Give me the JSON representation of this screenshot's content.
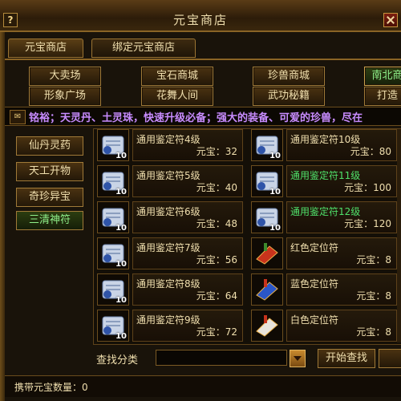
{
  "window": {
    "title": "元宝商店"
  },
  "tabs": [
    {
      "label": "元宝商店"
    },
    {
      "label": "绑定元宝商店"
    }
  ],
  "categories_row1": [
    {
      "label": "大卖场"
    },
    {
      "label": "宝石商城"
    },
    {
      "label": "珍兽商城"
    },
    {
      "label": "南北商"
    }
  ],
  "categories_row2": [
    {
      "label": "形象广场"
    },
    {
      "label": "花舞人间"
    },
    {
      "label": "武功秘籍"
    },
    {
      "label": "打造"
    }
  ],
  "marquee": {
    "text": "铭裕；天灵丹、土灵珠，快速升级必备；强大的装备、可爱的珍兽，尽在"
  },
  "sidebar": [
    {
      "label": "仙丹灵药"
    },
    {
      "label": "天工开物"
    },
    {
      "label": "奇珍异宝"
    },
    {
      "label": "三清神符"
    }
  ],
  "items": [
    {
      "name": "通用鉴定符4级",
      "price": "元宝：32",
      "qty": "10",
      "icon": "scroll-icon",
      "green": false
    },
    {
      "name": "通用鉴定符10级",
      "price": "元宝：80",
      "qty": "10",
      "icon": "scroll-icon",
      "green": false
    },
    {
      "name": "通用鉴定符5级",
      "price": "元宝：40",
      "qty": "10",
      "icon": "scroll-icon",
      "green": false
    },
    {
      "name": "通用鉴定符11级",
      "price": "元宝：100",
      "qty": "10",
      "icon": "scroll-icon",
      "green": true
    },
    {
      "name": "通用鉴定符6级",
      "price": "元宝：48",
      "qty": "10",
      "icon": "scroll-icon",
      "green": false
    },
    {
      "name": "通用鉴定符12级",
      "price": "元宝：120",
      "qty": "10",
      "icon": "scroll-icon",
      "green": true
    },
    {
      "name": "通用鉴定符7级",
      "price": "元宝：56",
      "qty": "10",
      "icon": "scroll-icon",
      "green": false
    },
    {
      "name": "红色定位符",
      "price": "元宝：8",
      "qty": "",
      "icon": "red-talisman-icon",
      "green": false
    },
    {
      "name": "通用鉴定符8级",
      "price": "元宝：64",
      "qty": "10",
      "icon": "scroll-icon",
      "green": false
    },
    {
      "name": "蓝色定位符",
      "price": "元宝：8",
      "qty": "",
      "icon": "blue-talisman-icon",
      "green": false
    },
    {
      "name": "通用鉴定符9级",
      "price": "元宝：72",
      "qty": "10",
      "icon": "scroll-icon",
      "green": false
    },
    {
      "name": "白色定位符",
      "price": "元宝：8",
      "qty": "",
      "icon": "white-talisman-icon",
      "green": false
    }
  ],
  "search": {
    "label": "查找分类",
    "value": "",
    "button": "开始查找"
  },
  "status": {
    "text": "携带元宝数量：0"
  },
  "colors": {
    "gold_text": "#f0dfae",
    "green_text": "#4fe06a",
    "marquee_text": "#c88cff",
    "border": "#a07a38"
  }
}
